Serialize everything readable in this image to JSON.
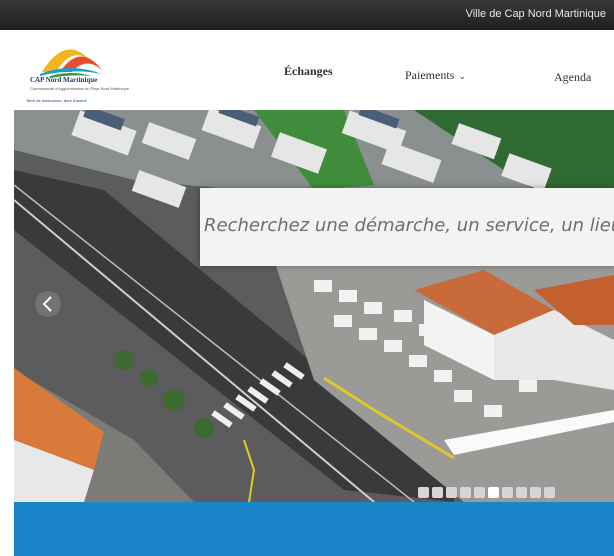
{
  "topbar": {
    "text": "Ville de Cap Nord Martinique"
  },
  "logo": {
    "name": "CAP Nord Martinique",
    "subtitle": "Communauté d'Agglomération du Pays Nord Martinique",
    "tagline": "Terre de ressources, terre d'avenir"
  },
  "nav": {
    "items": [
      {
        "label": "Échanges"
      },
      {
        "label": "Paiements"
      },
      {
        "label": "Agenda"
      }
    ]
  },
  "search": {
    "placeholder": "Recherchez une démarche, un service, un lieu..."
  },
  "slider": {
    "slide_count": 10,
    "active_index": 5
  },
  "colors": {
    "topbar": "#2a2a2a",
    "band": "#1a86c9",
    "brand_navy": "#1f3a6b"
  }
}
